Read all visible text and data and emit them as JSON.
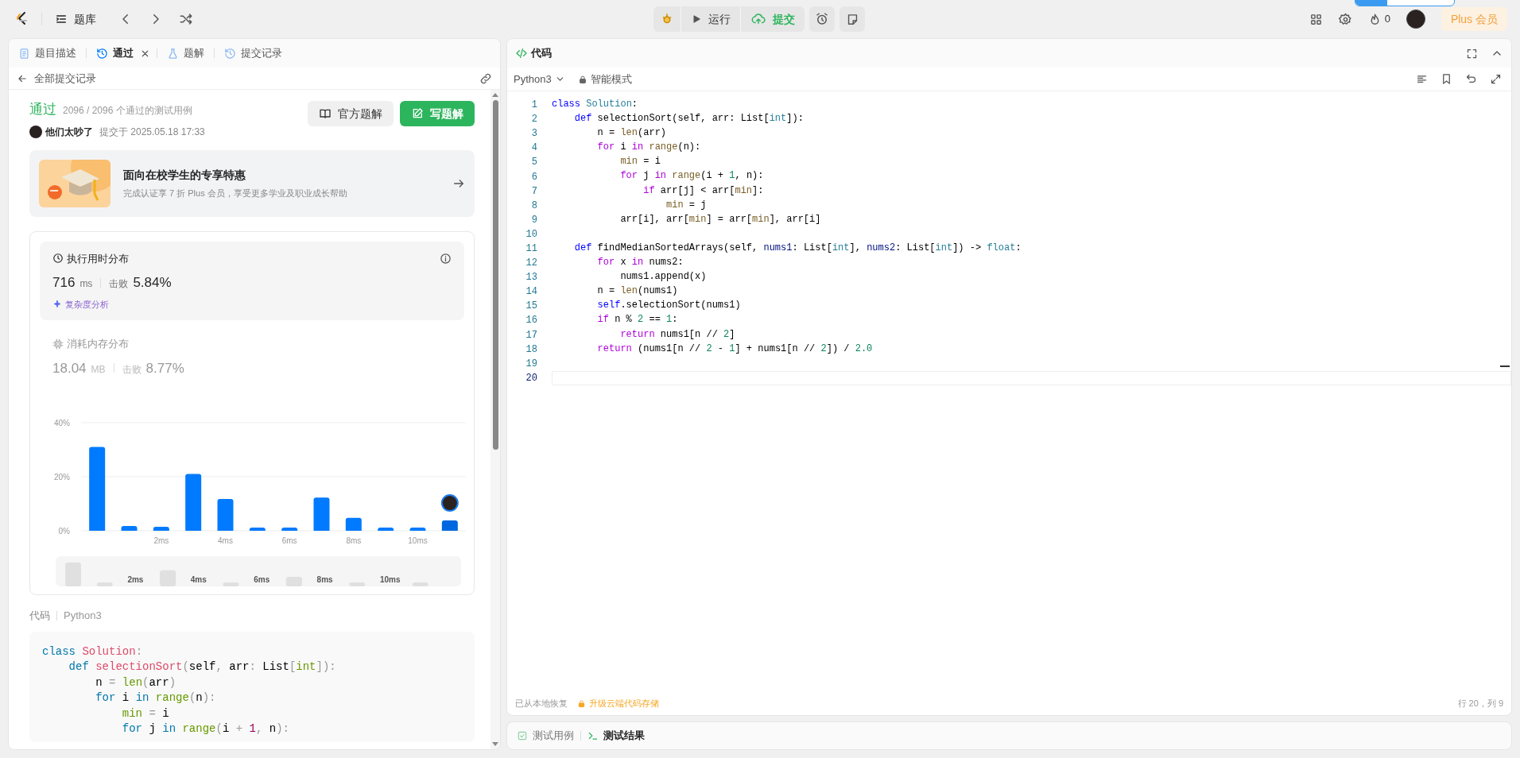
{
  "top_bar": {
    "problem_bank": "题库",
    "run": "运行",
    "submit": "提交",
    "fire_count": "0",
    "plus": "Plus 会员"
  },
  "left_panel": {
    "tabs": [
      {
        "label": "题目描述",
        "selected": false,
        "closable": false
      },
      {
        "label": "通过",
        "selected": true,
        "closable": true
      },
      {
        "label": "题解",
        "selected": false,
        "closable": false
      },
      {
        "label": "提交记录",
        "selected": false,
        "closable": false
      }
    ],
    "back_link": "全部提交记录",
    "result": {
      "status": "通过",
      "cases": "2096 / 2096 个通过的测试用例",
      "user": "他们太吵了",
      "submitted": "提交于 2025.05.18 17:33"
    },
    "buttons": [
      {
        "label": "官方题解",
        "kind": "secondary"
      },
      {
        "label": "写题解",
        "kind": "primary"
      }
    ],
    "promo": {
      "title": "面向在校学生的专享特惠",
      "subtitle": "完成认证享 7 折 Plus 会员，享受更多学业及职业成长帮助"
    },
    "metrics": [
      {
        "title": "执行用时分布",
        "value": "716",
        "unit": "ms",
        "beat_label": "击败",
        "beat": "5.84%",
        "selected": true,
        "link": "复杂度分析"
      },
      {
        "title": "消耗内存分布",
        "value": "18.04",
        "unit": "MB",
        "beat_label": "击败",
        "beat": "8.77%",
        "selected": false
      }
    ],
    "chart_data": {
      "type": "bar",
      "x": [
        0,
        1,
        2,
        3,
        4,
        5,
        6,
        7,
        8,
        9,
        10,
        11
      ],
      "xlim": [
        -0.5,
        11.5
      ],
      "series": [
        {
          "color": "#007aff",
          "values": [
            31,
            1.8,
            1.5,
            21,
            11.8,
            1.2,
            1.2,
            12.3,
            4.8,
            1.2,
            1.2,
            null
          ]
        },
        {
          "color": "#0067e0",
          "values": [
            null,
            null,
            null,
            null,
            null,
            null,
            null,
            null,
            null,
            null,
            null,
            3.8
          ]
        }
      ],
      "ylim": [
        0,
        40
      ],
      "yticks": [
        {
          "value": 0,
          "label": "0%"
        },
        {
          "value": 20,
          "label": "20%"
        },
        {
          "value": 40,
          "label": "40%"
        }
      ],
      "xticks": [
        {
          "value": 2,
          "label": "2ms"
        },
        {
          "value": 4,
          "label": "4ms"
        },
        {
          "value": 6,
          "label": "6ms"
        },
        {
          "value": 8,
          "label": "8ms"
        },
        {
          "value": 10,
          "label": "10ms"
        }
      ]
    },
    "navigator_labels": [
      "2ms",
      "4ms",
      "6ms",
      "8ms",
      "10ms"
    ],
    "code_label": "代码",
    "code_language": "Python3",
    "code_lines": [
      [
        {
          "kind": "keyword",
          "text": "class"
        },
        {
          "kind": "name",
          "text": " Solution"
        },
        {
          "kind": "punct",
          "text": ":"
        }
      ],
      [
        {
          "kind": "keyword",
          "text": "    def"
        },
        {
          "kind": "name",
          "text": " selectionSort"
        },
        {
          "kind": "punct",
          "text": "("
        },
        {
          "kind": "plain",
          "text": "self"
        },
        {
          "kind": "punct",
          "text": ","
        },
        {
          "kind": "plain",
          "text": " arr"
        },
        {
          "kind": "punct",
          "text": ":"
        },
        {
          "kind": "plain",
          "text": " List"
        },
        {
          "kind": "punct",
          "text": "["
        },
        {
          "kind": "builtin",
          "text": "int"
        },
        {
          "kind": "punct",
          "text": "]):"
        }
      ],
      [
        {
          "kind": "plain",
          "text": "        n"
        },
        {
          "kind": "punct",
          "text": " ="
        },
        {
          "kind": "builtin",
          "text": " len"
        },
        {
          "kind": "punct",
          "text": "("
        },
        {
          "kind": "plain",
          "text": "arr"
        },
        {
          "kind": "punct",
          "text": ")"
        }
      ],
      [
        {
          "kind": "keyword",
          "text": "        for"
        },
        {
          "kind": "plain",
          "text": " i"
        },
        {
          "kind": "keyword",
          "text": " in"
        },
        {
          "kind": "builtin",
          "text": " range"
        },
        {
          "kind": "punct",
          "text": "("
        },
        {
          "kind": "plain",
          "text": "n"
        },
        {
          "kind": "punct",
          "text": "):"
        }
      ],
      [
        {
          "kind": "builtin",
          "text": "            min"
        },
        {
          "kind": "punct",
          "text": " ="
        },
        {
          "kind": "plain",
          "text": " i"
        }
      ],
      [
        {
          "kind": "keyword",
          "text": "            for"
        },
        {
          "kind": "plain",
          "text": " j"
        },
        {
          "kind": "keyword",
          "text": " in"
        },
        {
          "kind": "builtin",
          "text": " range"
        },
        {
          "kind": "punct",
          "text": "("
        },
        {
          "kind": "plain",
          "text": "i"
        },
        {
          "kind": "punct",
          "text": " +"
        },
        {
          "kind": "number",
          "text": " 1"
        },
        {
          "kind": "punct",
          "text": ","
        },
        {
          "kind": "plain",
          "text": " n"
        },
        {
          "kind": "punct",
          "text": "):"
        }
      ]
    ]
  },
  "editor": {
    "title": "代码",
    "language": "Python3",
    "mode": "智能模式",
    "lines": [
      {
        "number": "1",
        "current": false,
        "tokens": [
          {
            "kind": "keyword",
            "text": "class"
          },
          {
            "kind": "type",
            "text": " Solution"
          },
          {
            "kind": "plain",
            "text": ":"
          }
        ]
      },
      {
        "number": "2",
        "current": false,
        "tokens": [
          {
            "kind": "keyword",
            "text": "    def"
          },
          {
            "kind": "plain",
            "text": " selectionSort(self, arr: List["
          },
          {
            "kind": "type",
            "text": "int"
          },
          {
            "kind": "plain",
            "text": "]):"
          }
        ]
      },
      {
        "number": "3",
        "current": false,
        "tokens": [
          {
            "kind": "plain",
            "text": "        n = "
          },
          {
            "kind": "function",
            "text": "len"
          },
          {
            "kind": "plain",
            "text": "(arr)"
          }
        ]
      },
      {
        "number": "4",
        "current": false,
        "tokens": [
          {
            "kind": "control",
            "text": "        for"
          },
          {
            "kind": "plain",
            "text": " i"
          },
          {
            "kind": "control",
            "text": " in"
          },
          {
            "kind": "function",
            "text": " range"
          },
          {
            "kind": "plain",
            "text": "(n):"
          }
        ]
      },
      {
        "number": "5",
        "current": false,
        "tokens": [
          {
            "kind": "function",
            "text": "            min"
          },
          {
            "kind": "plain",
            "text": " = i"
          }
        ]
      },
      {
        "number": "6",
        "current": false,
        "tokens": [
          {
            "kind": "control",
            "text": "            for"
          },
          {
            "kind": "plain",
            "text": " j"
          },
          {
            "kind": "control",
            "text": " in"
          },
          {
            "kind": "function",
            "text": " range"
          },
          {
            "kind": "plain",
            "text": "(i + "
          },
          {
            "kind": "number",
            "text": "1"
          },
          {
            "kind": "plain",
            "text": ", n):"
          }
        ]
      },
      {
        "number": "7",
        "current": false,
        "tokens": [
          {
            "kind": "control",
            "text": "                if"
          },
          {
            "kind": "plain",
            "text": " arr[j] < arr["
          },
          {
            "kind": "function",
            "text": "min"
          },
          {
            "kind": "plain",
            "text": "]:"
          }
        ]
      },
      {
        "number": "8",
        "current": false,
        "tokens": [
          {
            "kind": "function",
            "text": "                    min"
          },
          {
            "kind": "plain",
            "text": " = j"
          }
        ]
      },
      {
        "number": "9",
        "current": false,
        "tokens": [
          {
            "kind": "plain",
            "text": "            arr[i], arr["
          },
          {
            "kind": "function",
            "text": "min"
          },
          {
            "kind": "plain",
            "text": "] = arr["
          },
          {
            "kind": "function",
            "text": "min"
          },
          {
            "kind": "plain",
            "text": "], arr[i]"
          }
        ]
      },
      {
        "number": "10",
        "current": false
      },
      {
        "number": "11",
        "current": false,
        "tokens": [
          {
            "kind": "keyword",
            "text": "    def"
          },
          {
            "kind": "plain",
            "text": " findMedianSortedArrays(self, "
          },
          {
            "kind": "param",
            "text": "nums1"
          },
          {
            "kind": "plain",
            "text": ": List["
          },
          {
            "kind": "type",
            "text": "int"
          },
          {
            "kind": "plain",
            "text": "], "
          },
          {
            "kind": "param",
            "text": "nums2"
          },
          {
            "kind": "plain",
            "text": ": List["
          },
          {
            "kind": "type",
            "text": "int"
          },
          {
            "kind": "plain",
            "text": "]) -> "
          },
          {
            "kind": "type",
            "text": "float"
          },
          {
            "kind": "plain",
            "text": ":"
          }
        ]
      },
      {
        "number": "12",
        "current": false,
        "tokens": [
          {
            "kind": "control",
            "text": "        for"
          },
          {
            "kind": "plain",
            "text": " x"
          },
          {
            "kind": "control",
            "text": " in"
          },
          {
            "kind": "plain",
            "text": " nums2:"
          }
        ]
      },
      {
        "number": "13",
        "current": false,
        "tokens": [
          {
            "kind": "plain",
            "text": "            nums1.append(x)"
          }
        ]
      },
      {
        "number": "14",
        "current": false,
        "tokens": [
          {
            "kind": "plain",
            "text": "        n = "
          },
          {
            "kind": "function",
            "text": "len"
          },
          {
            "kind": "plain",
            "text": "(nums1)"
          }
        ]
      },
      {
        "number": "15",
        "current": false,
        "tokens": [
          {
            "kind": "keyword",
            "text": "        self"
          },
          {
            "kind": "plain",
            "text": ".selectionSort(nums1)"
          }
        ]
      },
      {
        "number": "16",
        "current": false,
        "tokens": [
          {
            "kind": "control",
            "text": "        if"
          },
          {
            "kind": "plain",
            "text": " n % "
          },
          {
            "kind": "number",
            "text": "2"
          },
          {
            "kind": "plain",
            "text": " == "
          },
          {
            "kind": "number",
            "text": "1"
          },
          {
            "kind": "plain",
            "text": ":"
          }
        ]
      },
      {
        "number": "17",
        "current": false,
        "tokens": [
          {
            "kind": "control",
            "text": "            return"
          },
          {
            "kind": "plain",
            "text": " nums1[n // "
          },
          {
            "kind": "number",
            "text": "2"
          },
          {
            "kind": "plain",
            "text": "]"
          }
        ]
      },
      {
        "number": "18",
        "current": false,
        "tokens": [
          {
            "kind": "control",
            "text": "        return"
          },
          {
            "kind": "plain",
            "text": " (nums1[n // "
          },
          {
            "kind": "number",
            "text": "2"
          },
          {
            "kind": "plain",
            "text": " - "
          },
          {
            "kind": "number",
            "text": "1"
          },
          {
            "kind": "plain",
            "text": "] + nums1[n // "
          },
          {
            "kind": "number",
            "text": "2"
          },
          {
            "kind": "plain",
            "text": "]) / "
          },
          {
            "kind": "number",
            "text": "2.0"
          }
        ]
      },
      {
        "number": "19",
        "current": false
      },
      {
        "number": "20",
        "current": true
      }
    ],
    "restored": "已从本地恢复",
    "upgrade": "升级云端代码存储",
    "cursor": "行 20，列 9"
  },
  "bottom_tabs": [
    {
      "label": "测试用例",
      "selected": false
    },
    {
      "label": "测试结果",
      "selected": true
    }
  ]
}
